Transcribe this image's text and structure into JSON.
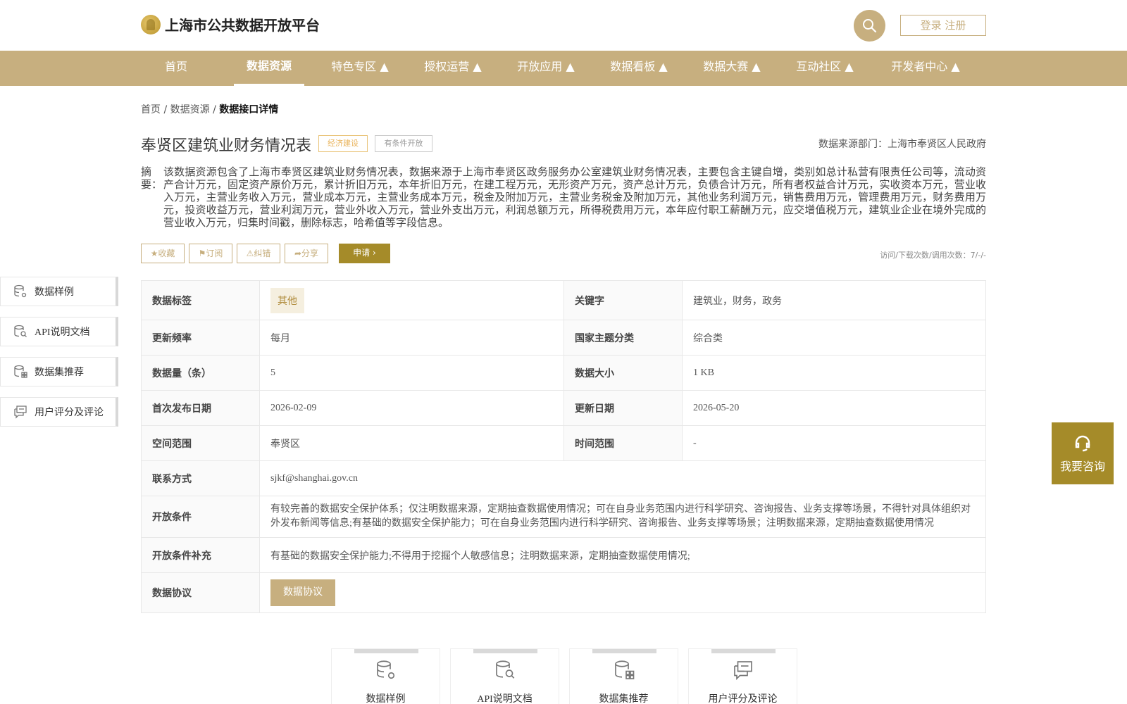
{
  "header": {
    "site_title": "上海市公共数据开放平台",
    "login_label": "登录 注册"
  },
  "nav": {
    "items": [
      {
        "label": "首页"
      },
      {
        "label": "数据资源"
      },
      {
        "label": "特色专区 ▲"
      },
      {
        "label": "授权运营 ▲"
      },
      {
        "label": "开放应用 ▲"
      },
      {
        "label": "数据看板 ▲"
      },
      {
        "label": "数据大赛 ▲"
      },
      {
        "label": "互动社区 ▲"
      },
      {
        "label": "开发者中心 ▲"
      }
    ]
  },
  "breadcrumb": {
    "home": "首页",
    "sep": "/",
    "section": "数据资源",
    "current": "数据接口详情"
  },
  "dataset": {
    "title": "奉贤区建筑业财务情况表",
    "tag_category": "经济建设",
    "tag_open": "有条件开放",
    "source": "数据来源部门：上海市奉贤区人民政府",
    "abstract_label": "摘要：",
    "abstract": "该数据资源包含了上海市奉贤区建筑业财务情况表，数据来源于上海市奉贤区政务服务办公室建筑业财务情况表，主要包含主键自增，类别如总计私营有限责任公司等，流动资产合计万元，固定资产原价万元，累计折旧万元，本年折旧万元，在建工程万元，无形资产万元，资产总计万元，负债合计万元，所有者权益合计万元，实收资本万元，营业收入万元，主营业务收入万元，营业成本万元，主营业务成本万元，税金及附加万元，主营业务税金及附加万元，其他业务利润万元，销售费用万元，管理费用万元，财务费用万元，投资收益万元，营业利润万元，营业外收入万元，营业外支出万元，利润总额万元，所得税费用万元，本年应付职工薪酬万元，应交增值税万元，建筑业企业在境外完成的营业收入万元，归集时间戳，删除标志，哈希值等字段信息。"
  },
  "actions": {
    "favorite": "收藏",
    "subscribe": "订阅",
    "report": "纠错",
    "share": "分享",
    "apply": "申请",
    "visits": "访问/下载次数/调用次数：7/-/-"
  },
  "sidebar": {
    "items": [
      {
        "label": "数据样例"
      },
      {
        "label": "API说明文档"
      },
      {
        "label": "数据集推荐"
      },
      {
        "label": "用户评分及评论"
      }
    ]
  },
  "info": {
    "data_tag_label": "数据标签",
    "data_tag_value": "其他",
    "keywords_label": "关键字",
    "keywords_value": "建筑业，财务，政务",
    "frequency_label": "更新频率",
    "frequency_value": "每月",
    "theme_label": "国家主题分类",
    "theme_value": "综合类",
    "count_label": "数据量（条）",
    "count_value": "5",
    "size_label": "数据大小",
    "size_value": "1 KB",
    "first_pub_label": "首次发布日期",
    "first_pub_value": "2026-02-09",
    "update_label": "更新日期",
    "update_value": "2026-05-20",
    "space_label": "空间范围",
    "space_value": "奉贤区",
    "time_label": "时间范围",
    "time_value": "-",
    "contact_label": "联系方式",
    "contact_value": "sjkf@shanghai.gov.cn",
    "open_cond_label": "开放条件",
    "open_cond_value": "有较完善的数据安全保护体系；仅注明数据来源，定期抽查数据使用情况；可在自身业务范围内进行科学研究、咨询报告、业务支撑等场景，不得针对具体组织对外发布新闻等信息;有基础的数据安全保护能力；可在自身业务范围内进行科学研究、咨询报告、业务支撑等场景；注明数据来源，定期抽查数据使用情况",
    "open_supp_label": "开放条件补充",
    "open_supp_value": "有基础的数据安全保护能力;不得用于挖掘个人敏感信息；注明数据来源，定期抽查数据使用情况;",
    "protocol_label": "数据协议",
    "protocol_button": "数据协议"
  },
  "consult": {
    "label": "我要咨询"
  },
  "bottom_tabs": [
    {
      "label": "数据样例"
    },
    {
      "label": "API说明文档"
    },
    {
      "label": "数据集推荐"
    },
    {
      "label": "用户评分及评论"
    }
  ],
  "colors": {
    "brand_gold": "#c7af7f",
    "apply_dark_gold": "#a58b29",
    "tag_orange": "#e9b35a"
  }
}
